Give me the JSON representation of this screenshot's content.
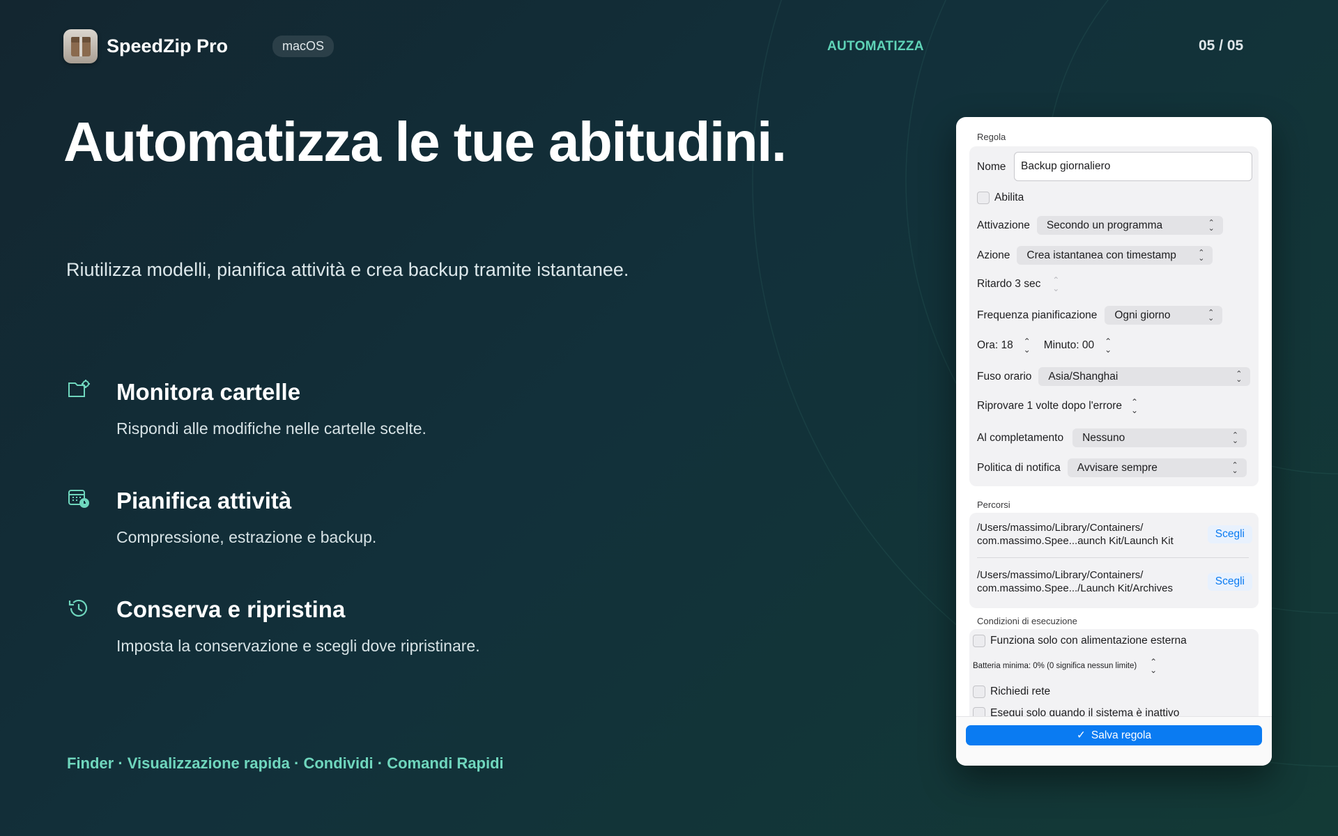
{
  "header": {
    "app_name": "SpeedZip Pro",
    "platform_badge": "macOS",
    "section_label": "AUTOMATIZZA",
    "page_counter": "05 / 05"
  },
  "hero": {
    "headline": "Automatizza le tue abitudini.",
    "subtitle": "Riutilizza modelli, pianifica attività e crea backup tramite istantanee."
  },
  "features": [
    {
      "icon": "folder-gear-icon",
      "title": "Monitora cartelle",
      "description": "Rispondi alle modifiche nelle cartelle scelte."
    },
    {
      "icon": "calendar-clock-icon",
      "title": "Pianifica attività",
      "description": "Compressione, estrazione e backup."
    },
    {
      "icon": "history-icon",
      "title": "Conserva e ripristina",
      "description": "Imposta la conservazione e scegli dove ripristinare."
    }
  ],
  "integrations": "Finder · Visualizzazione rapida · Condividi · Comandi Rapidi",
  "panel": {
    "rule_section": "Regola",
    "name_label": "Nome",
    "name_value": "Backup giornaliero",
    "enable_label": "Abilita",
    "trigger_label": "Attivazione",
    "trigger_value": "Secondo un programma",
    "action_label": "Azione",
    "action_value": "Crea istantanea con timestamp",
    "delay_label": "Ritardo 3 sec",
    "frequency_label": "Frequenza pianificazione",
    "frequency_value": "Ogni giorno",
    "hour_label": "Ora: 18",
    "minute_label": "Minuto: 00",
    "timezone_label": "Fuso orario",
    "timezone_value": "Asia/Shanghai",
    "retry_label": "Riprovare 1 volte dopo l'errore",
    "completion_label": "Al completamento",
    "completion_value": "Nessuno",
    "notify_label": "Politica di notifica",
    "notify_value": "Avvisare sempre",
    "paths_section": "Percorsi",
    "path1_line1": "/Users/massimo/Library/Containers/",
    "path1_line2": "com.massimo.Spee...aunch Kit/Launch Kit",
    "path2_line1": "/Users/massimo/Library/Containers/",
    "path2_line2": "com.massimo.Spee.../Launch Kit/Archives",
    "choose_label": "Scegli",
    "conditions_section": "Condizioni di esecuzione",
    "external_power_label": "Funziona solo con alimentazione esterna",
    "battery_label": "Batteria minima: 0% (0 significa nessun limite)",
    "network_label": "Richiedi rete",
    "idle_label": "Esegui solo quando il sistema è inattivo",
    "save_label": "Salva regola"
  },
  "colors": {
    "accent": "#6fd6bd",
    "button_blue": "#0a7bf2"
  }
}
